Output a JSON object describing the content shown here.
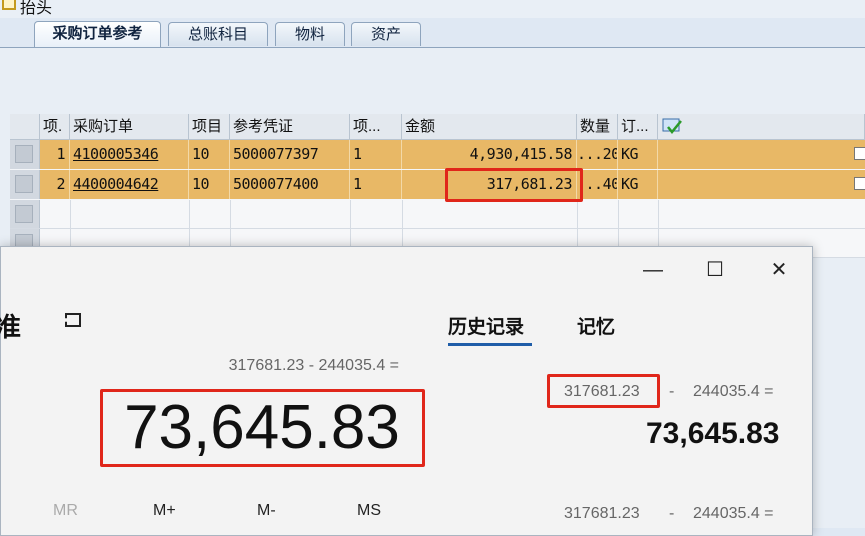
{
  "header": {
    "title": "抬头",
    "icon": "header-doc-icon"
  },
  "tabs": [
    {
      "label": "采购订单参考",
      "active": true
    },
    {
      "label": "总账科目"
    },
    {
      "label": "物料"
    },
    {
      "label": "资产"
    }
  ],
  "table": {
    "columns": [
      "项.",
      "采购订单",
      "项目",
      "参考凭证",
      "项...",
      "金额",
      "数量",
      "订..."
    ],
    "rows": [
      {
        "item": "1",
        "po": "4100005346",
        "po_item": "10",
        "ref_doc": "5000077397",
        "ref_item": "1",
        "amount": "4,930,415.58",
        "qty": "...20",
        "unit": "KG"
      },
      {
        "item": "2",
        "po": "4400004642",
        "po_item": "10",
        "ref_doc": "5000077400",
        "ref_item": "1",
        "amount": "317,681.23",
        "qty": "...40",
        "unit": "KG"
      }
    ],
    "row_color": "#e8b866"
  },
  "calculator": {
    "mode_title": "准",
    "window_buttons": {
      "minimize": "—",
      "maximize": "☐",
      "close": "✕"
    },
    "expression": "317681.23 - 244035.4 =",
    "result": "73,645.83",
    "memory_buttons": {
      "mc_mr": "MR",
      "mplus": "M+",
      "mminus": "M-",
      "ms": "MS"
    },
    "panel_tabs": {
      "history": "历史记录",
      "memory": "记忆"
    },
    "history": [
      {
        "a": "317681.23",
        "op": "-",
        "b": "244035.4 =",
        "result": "73,645.83"
      },
      {
        "a": "317681.23",
        "op": "-",
        "b": "244035.4 ="
      }
    ]
  },
  "colors": {
    "highlight_box": "#e0261a",
    "accent": "#1f5da8"
  }
}
